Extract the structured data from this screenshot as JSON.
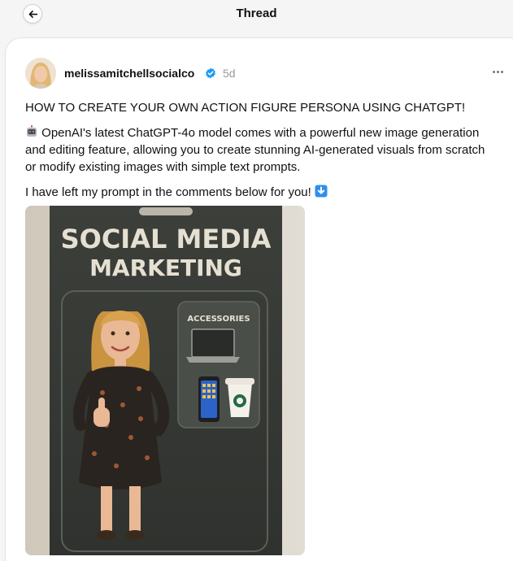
{
  "header": {
    "title": "Thread"
  },
  "post": {
    "username": "melissamitchellsocialco",
    "timestamp": "5d",
    "headline": "HOW TO CREATE YOUR OWN ACTION FIGURE PERSONA USING CHATGPT!",
    "body": "OpenAI's latest ChatGPT-4o model comes with a powerful new image generation and editing feature, allowing you to create stunning AI-generated visuals from scratch or modify existing images with simple text prompts.",
    "cta": "I have left my prompt in the comments below for you!",
    "image": {
      "title_line1": "SOCIAL MEDIA",
      "title_line2": "MARKETING",
      "accessories_label": "ACCESSORIES"
    }
  },
  "colors": {
    "verified_badge": "#1d9bf0",
    "timestamp": "#999999",
    "package": "#3a3d38"
  }
}
